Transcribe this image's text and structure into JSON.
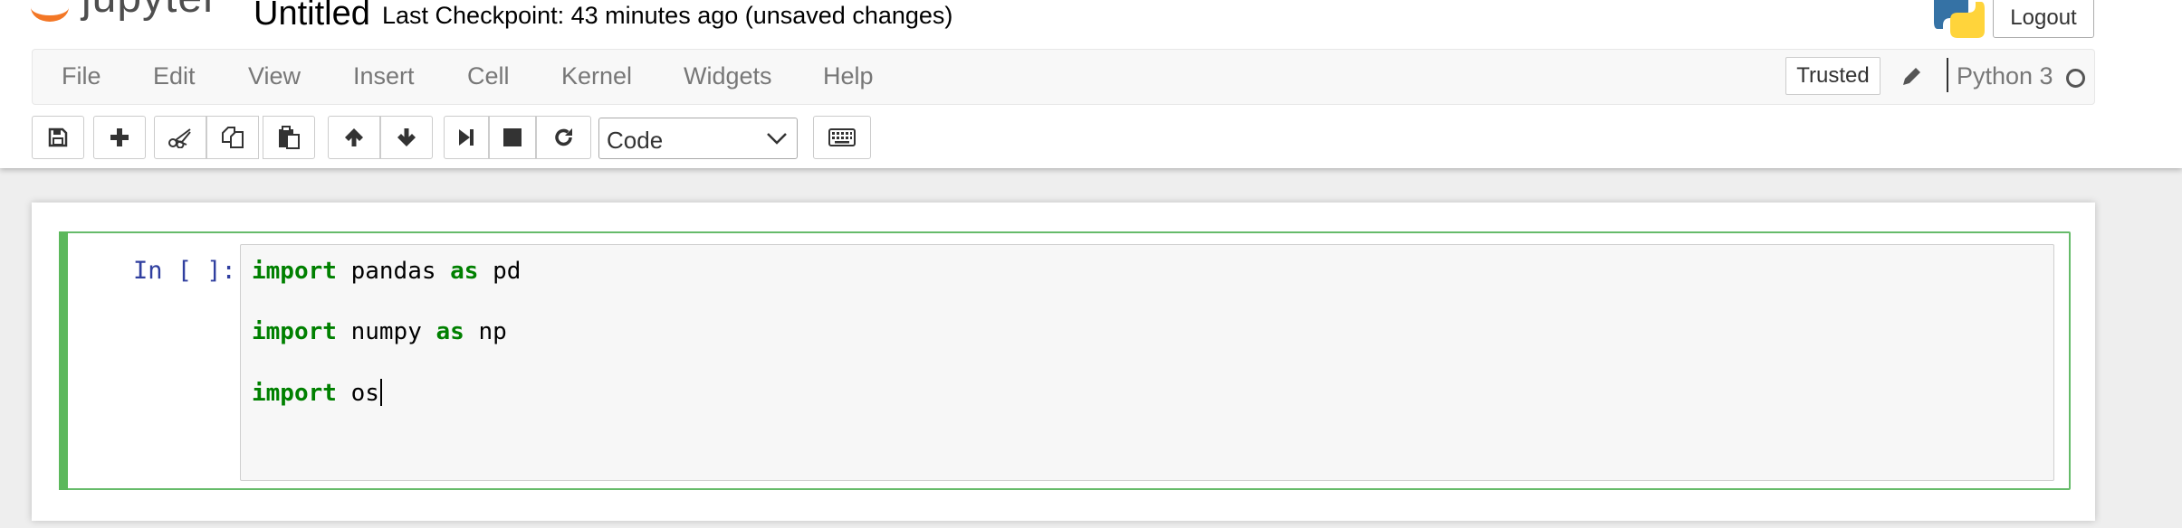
{
  "header": {
    "logo_text": "jupyter",
    "notebook_title": "Untitled",
    "checkpoint_text": "Last Checkpoint: 43 minutes ago (unsaved changes)",
    "logout_label": "Logout"
  },
  "menubar": {
    "items": [
      {
        "label": "File"
      },
      {
        "label": "Edit"
      },
      {
        "label": "View"
      },
      {
        "label": "Insert"
      },
      {
        "label": "Cell"
      },
      {
        "label": "Kernel"
      },
      {
        "label": "Widgets"
      },
      {
        "label": "Help"
      }
    ],
    "trusted_label": "Trusted",
    "kernel_name": "Python 3"
  },
  "toolbar": {
    "icons": [
      "save-icon",
      "plus-icon",
      "cut-icon",
      "copy-icon",
      "paste-icon",
      "arrow-up-icon",
      "arrow-down-icon",
      "step-forward-icon",
      "stop-icon",
      "refresh-icon",
      "keyboard-icon"
    ],
    "cell_type": "Code"
  },
  "cell": {
    "prompt": "In [ ]:",
    "lines": [
      {
        "keyword": "import",
        "rest_a": " pandas ",
        "keyword2": "as",
        "rest_b": " pd"
      },
      {
        "keyword": "import",
        "rest_a": " numpy ",
        "keyword2": "as",
        "rest_b": " np"
      },
      {
        "keyword": "import",
        "rest_a": " os",
        "keyword2": "",
        "rest_b": ""
      }
    ]
  },
  "colors": {
    "keyword": "#008000",
    "prompt": "#303f9f",
    "selected_cell_border": "#66bb6a",
    "selected_cell_bar": "#5cb85c",
    "jupyter_orange": "#f37726"
  }
}
